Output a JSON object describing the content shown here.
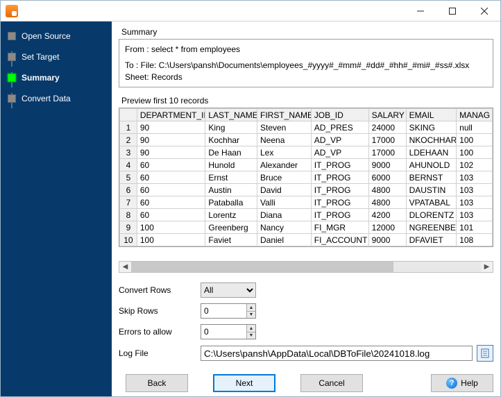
{
  "titlebar": {},
  "sidebar": {
    "steps": [
      {
        "label": "Open Source"
      },
      {
        "label": "Set Target"
      },
      {
        "label": "Summary"
      },
      {
        "label": "Convert Data"
      }
    ],
    "active_index": 2
  },
  "main": {
    "summary_label": "Summary",
    "summary_from": "From : select * from employees",
    "summary_to": "To : File: C:\\Users\\pansh\\Documents\\employees_#yyyy#_#mm#_#dd#_#hh#_#mi#_#ss#.xlsx Sheet: Records",
    "preview_label": "Preview first 10 records",
    "columns": [
      "DEPARTMENT_ID",
      "LAST_NAME",
      "FIRST_NAME",
      "JOB_ID",
      "SALARY",
      "EMAIL",
      "MANAG"
    ],
    "rows": [
      {
        "n": "1",
        "v": [
          "90",
          "King",
          "Steven",
          "AD_PRES",
          "24000",
          "SKING",
          "null"
        ]
      },
      {
        "n": "2",
        "v": [
          "90",
          "Kochhar",
          "Neena",
          "AD_VP",
          "17000",
          "NKOCHHAR",
          "100"
        ]
      },
      {
        "n": "3",
        "v": [
          "90",
          "De Haan",
          "Lex",
          "AD_VP",
          "17000",
          "LDEHAAN",
          "100"
        ]
      },
      {
        "n": "4",
        "v": [
          "60",
          "Hunold",
          "Alexander",
          "IT_PROG",
          "9000",
          "AHUNOLD",
          "102"
        ]
      },
      {
        "n": "5",
        "v": [
          "60",
          "Ernst",
          "Bruce",
          "IT_PROG",
          "6000",
          "BERNST",
          "103"
        ]
      },
      {
        "n": "6",
        "v": [
          "60",
          "Austin",
          "David",
          "IT_PROG",
          "4800",
          "DAUSTIN",
          "103"
        ]
      },
      {
        "n": "7",
        "v": [
          "60",
          "Pataballa",
          "Valli",
          "IT_PROG",
          "4800",
          "VPATABAL",
          "103"
        ]
      },
      {
        "n": "8",
        "v": [
          "60",
          "Lorentz",
          "Diana",
          "IT_PROG",
          "4200",
          "DLORENTZ",
          "103"
        ]
      },
      {
        "n": "9",
        "v": [
          "100",
          "Greenberg",
          "Nancy",
          "FI_MGR",
          "12000",
          "NGREENBE",
          "101"
        ]
      },
      {
        "n": "10",
        "v": [
          "100",
          "Faviet",
          "Daniel",
          "FI_ACCOUNT",
          "9000",
          "DFAVIET",
          "108"
        ]
      }
    ],
    "form": {
      "convert_rows_label": "Convert Rows",
      "convert_rows_value": "All",
      "skip_rows_label": "Skip Rows",
      "skip_rows_value": "0",
      "errors_label": "Errors to allow",
      "errors_value": "0",
      "logfile_label": "Log File",
      "logfile_value": "C:\\Users\\pansh\\AppData\\Local\\DBToFile\\20241018.log"
    },
    "buttons": {
      "back": "Back",
      "next": "Next",
      "cancel": "Cancel",
      "help": "Help"
    }
  }
}
